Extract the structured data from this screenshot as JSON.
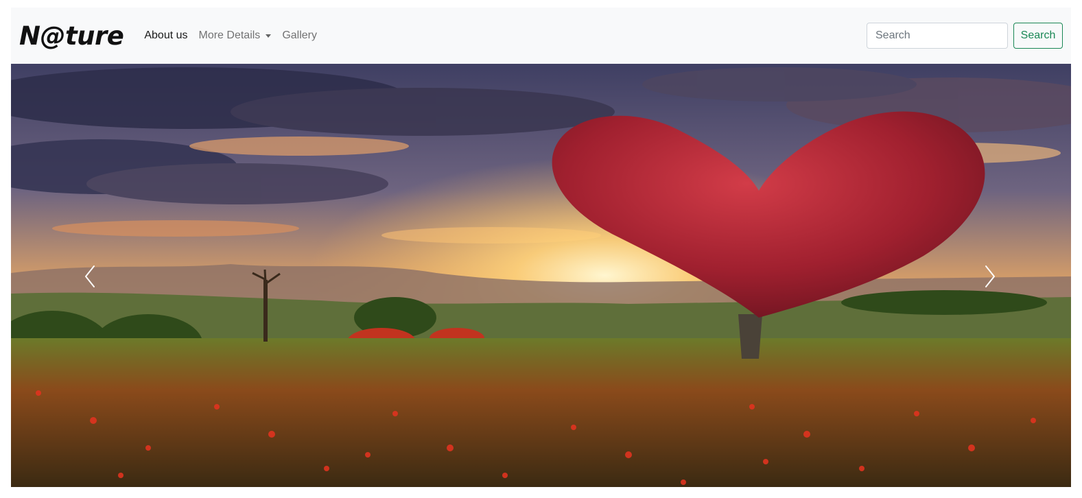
{
  "navbar": {
    "brand": "N@ture",
    "links": [
      {
        "label": "About us",
        "active": true
      },
      {
        "label": "More Details",
        "dropdown": true
      },
      {
        "label": "Gallery"
      }
    ],
    "search": {
      "placeholder": "Search",
      "button_label": "Search"
    }
  },
  "carousel": {
    "image_icon": "heart-tree-landscape-image",
    "prev_icon": "chevron-left-icon",
    "next_icon": "chevron-right-icon"
  },
  "colors": {
    "navbar_bg": "#f8f9fa",
    "search_button": "#198754"
  }
}
